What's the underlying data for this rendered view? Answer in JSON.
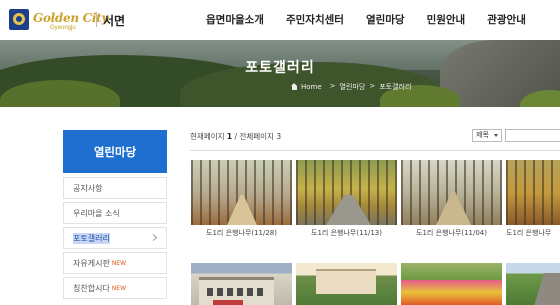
{
  "header": {
    "logo_text": "Golden City",
    "logo_sub": "Gyeongju",
    "district": "서면",
    "nav": [
      "읍면마을소개",
      "주민자치센터",
      "열린마당",
      "민원안내",
      "관광안내"
    ]
  },
  "hero": {
    "title": "포토갤러리",
    "breadcrumb": [
      "Home",
      "열린마당",
      "포토갤러리"
    ]
  },
  "sidebar": {
    "heading": "열린마당",
    "items": [
      {
        "label": "공지사항",
        "active": false,
        "badge": ""
      },
      {
        "label": "우리마을 소식",
        "active": false,
        "badge": ""
      },
      {
        "label": "포토갤러리",
        "active": true,
        "badge": ""
      },
      {
        "label": "자유게시판",
        "active": false,
        "badge": "NEW"
      },
      {
        "label": "칭찬합시다",
        "active": false,
        "badge": "NEW"
      }
    ]
  },
  "main": {
    "page_info": {
      "current_label": "현재페이지",
      "current": "1",
      "total_label": "전체페이지",
      "total": "3"
    },
    "search": {
      "select_value": "제목",
      "input_value": ""
    },
    "gallery": [
      {
        "caption": "도1리 은행나무(11/28)"
      },
      {
        "caption": "도1리 은행나무(11/13)"
      },
      {
        "caption": "도1리 은행나무(11/04)"
      },
      {
        "caption": "도1리 은행나무"
      },
      {
        "caption": ""
      },
      {
        "caption": ""
      },
      {
        "caption": ""
      },
      {
        "caption": ""
      }
    ]
  }
}
